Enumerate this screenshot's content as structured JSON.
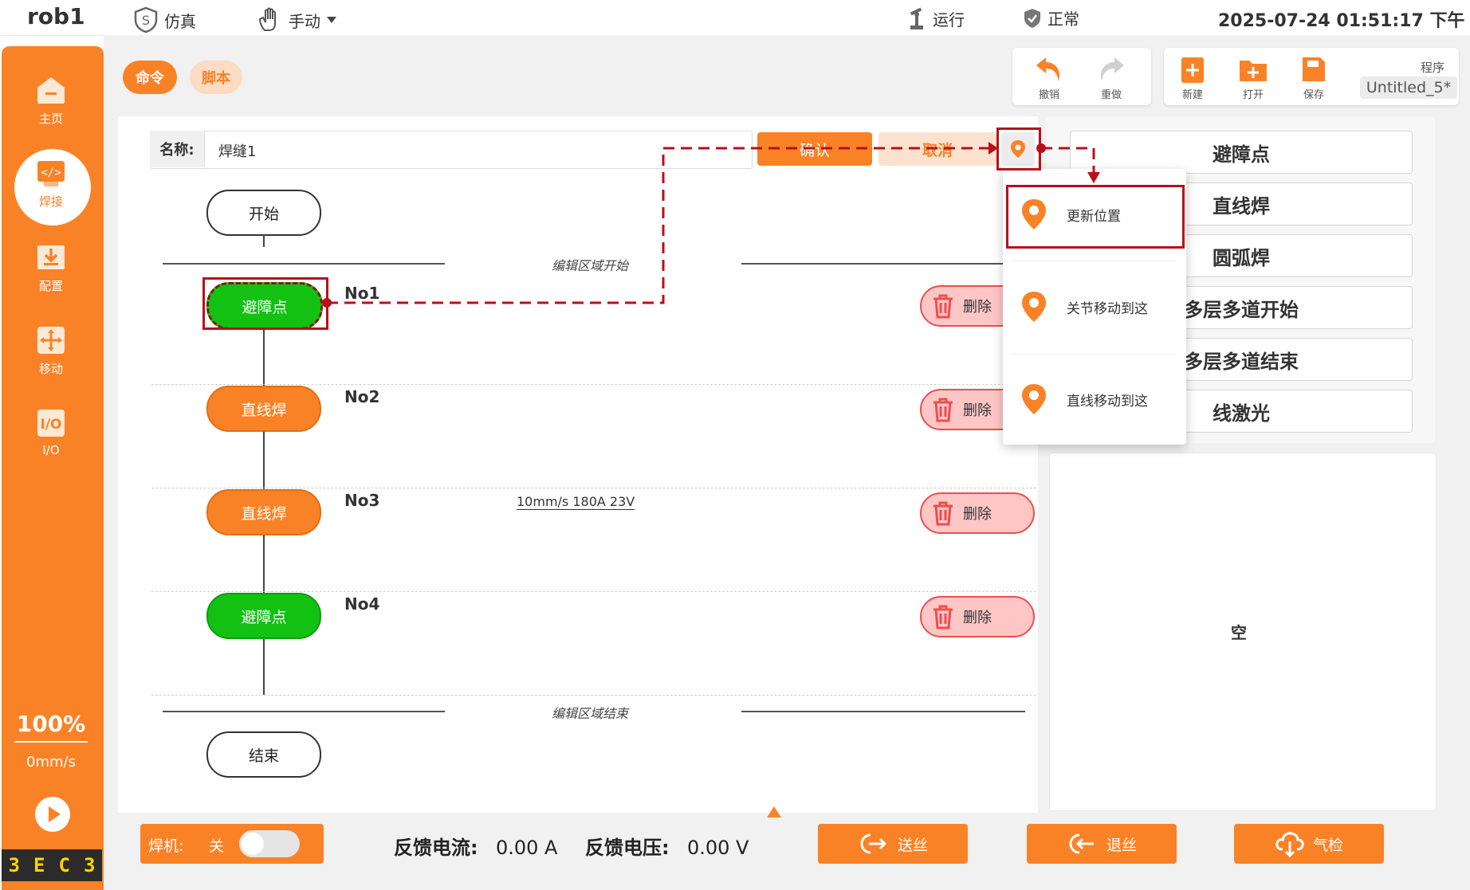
{
  "topbar": {
    "app_title": "rob1",
    "sim_label": "仿真",
    "mode_label": "手动",
    "run_label": "运行",
    "status_label": "正常",
    "datetime": "2025-07-24 01:51:17 下午"
  },
  "sidebar": {
    "items": [
      {
        "label": "主页",
        "icon": "home-icon"
      },
      {
        "label": "焊接",
        "icon": "code-icon"
      },
      {
        "label": "配置",
        "icon": "download-icon"
      },
      {
        "label": "移动",
        "icon": "move-icon"
      },
      {
        "label": "I/O",
        "icon": "io-icon"
      }
    ],
    "active_index": 1,
    "speed_percent": "100%",
    "speed_mm": "0mm/s",
    "logo_letters": [
      "3",
      "E",
      "C",
      "3"
    ]
  },
  "tabs": {
    "command": "命令",
    "script": "脚本"
  },
  "toolbar": {
    "undo": "撤销",
    "redo": "重做",
    "new": "新建",
    "open": "打开",
    "save": "保存",
    "program_label": "程序",
    "program_name": "Untitled_5*"
  },
  "editor": {
    "name_label": "名称:",
    "name_value": "焊缝1",
    "confirm": "确认",
    "cancel": "取消",
    "start": "开始",
    "end": "结束",
    "region_start": "编辑区域开始",
    "region_end": "编辑区域结束",
    "delete_label": "删除",
    "nodes": [
      {
        "no": "No1",
        "label": "避障点",
        "kind": "green"
      },
      {
        "no": "No2",
        "label": "直线焊",
        "kind": "orange"
      },
      {
        "no": "No3",
        "label": "直线焊",
        "kind": "orange"
      },
      {
        "no": "No4",
        "label": "避障点",
        "kind": "green"
      }
    ],
    "node3_params": "10mm/s 180A 23V"
  },
  "popup_menu": {
    "items": [
      "更新位置",
      "关节移动到这",
      "直线移动到这"
    ]
  },
  "command_list": [
    "避障点",
    "直线焊",
    "圆弧焊",
    "多层多道开始",
    "多层多道结束",
    "线激光"
  ],
  "preview": {
    "empty_text": "空"
  },
  "bottom": {
    "welder_label": "焊机:",
    "welder_state": "关",
    "current_label": "反馈电流:",
    "current_value": "0.00 A",
    "voltage_label": "反馈电压:",
    "voltage_value": "0.00 V",
    "wire_feed": "送丝",
    "wire_retract": "退丝",
    "gas_check": "气检"
  },
  "colors": {
    "accent": "#fa8226",
    "green": "#12c112",
    "annotation": "#b80f1c",
    "delete_bg": "#ffc6c6"
  }
}
